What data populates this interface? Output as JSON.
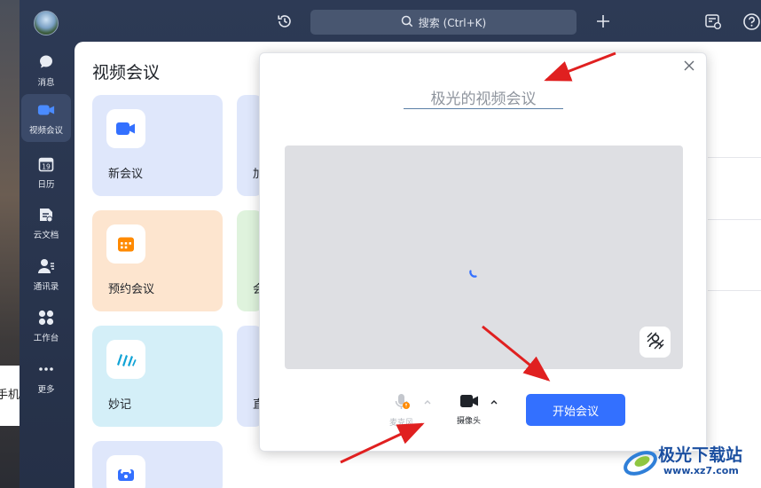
{
  "desktop": {
    "partial_text": "手机"
  },
  "sidebar": {
    "items": [
      {
        "label": "消息",
        "icon": "chat-bubble-icon"
      },
      {
        "label": "视频会议",
        "icon": "video-camera-icon"
      },
      {
        "label": "日历",
        "icon": "calendar-icon",
        "day": "19"
      },
      {
        "label": "云文档",
        "icon": "cloud-doc-icon"
      },
      {
        "label": "通讯录",
        "icon": "contacts-icon"
      },
      {
        "label": "工作台",
        "icon": "grid-icon"
      },
      {
        "label": "更多",
        "icon": "more-dots-icon"
      }
    ],
    "active_index": 1
  },
  "topbar": {
    "search_placeholder": "搜索 (Ctrl+K)"
  },
  "page": {
    "title": "视频会议",
    "cards": [
      {
        "label": "新会议",
        "color": "#dfe7fb",
        "icon": "video-camera-icon"
      },
      {
        "label": "加",
        "color": "#dfe7fb",
        "icon": "join-icon"
      },
      {
        "label": "预约会议",
        "color": "#fde5cf",
        "icon": "calendar-icon"
      },
      {
        "label": "会",
        "color": "#dff3dd",
        "icon": "share-icon"
      },
      {
        "label": "妙记",
        "color": "#d4eff8",
        "icon": "minutes-icon"
      },
      {
        "label": "直",
        "color": "#dfe7fb",
        "icon": "live-icon"
      },
      {
        "label": "",
        "color": "#dfe7fb",
        "icon": "phone-icon"
      }
    ]
  },
  "dialog": {
    "meeting_name": "极光的视频会议",
    "mic_label": "麦克风",
    "camera_label": "摄像头",
    "start_button": "开始会议"
  },
  "watermark": {
    "name": "极光下载站",
    "url": "www.xz7.com"
  },
  "colors": {
    "accent": "#3370ff",
    "sidebar_bg": "#2d3a55",
    "annotation_arrow": "#e02020"
  }
}
